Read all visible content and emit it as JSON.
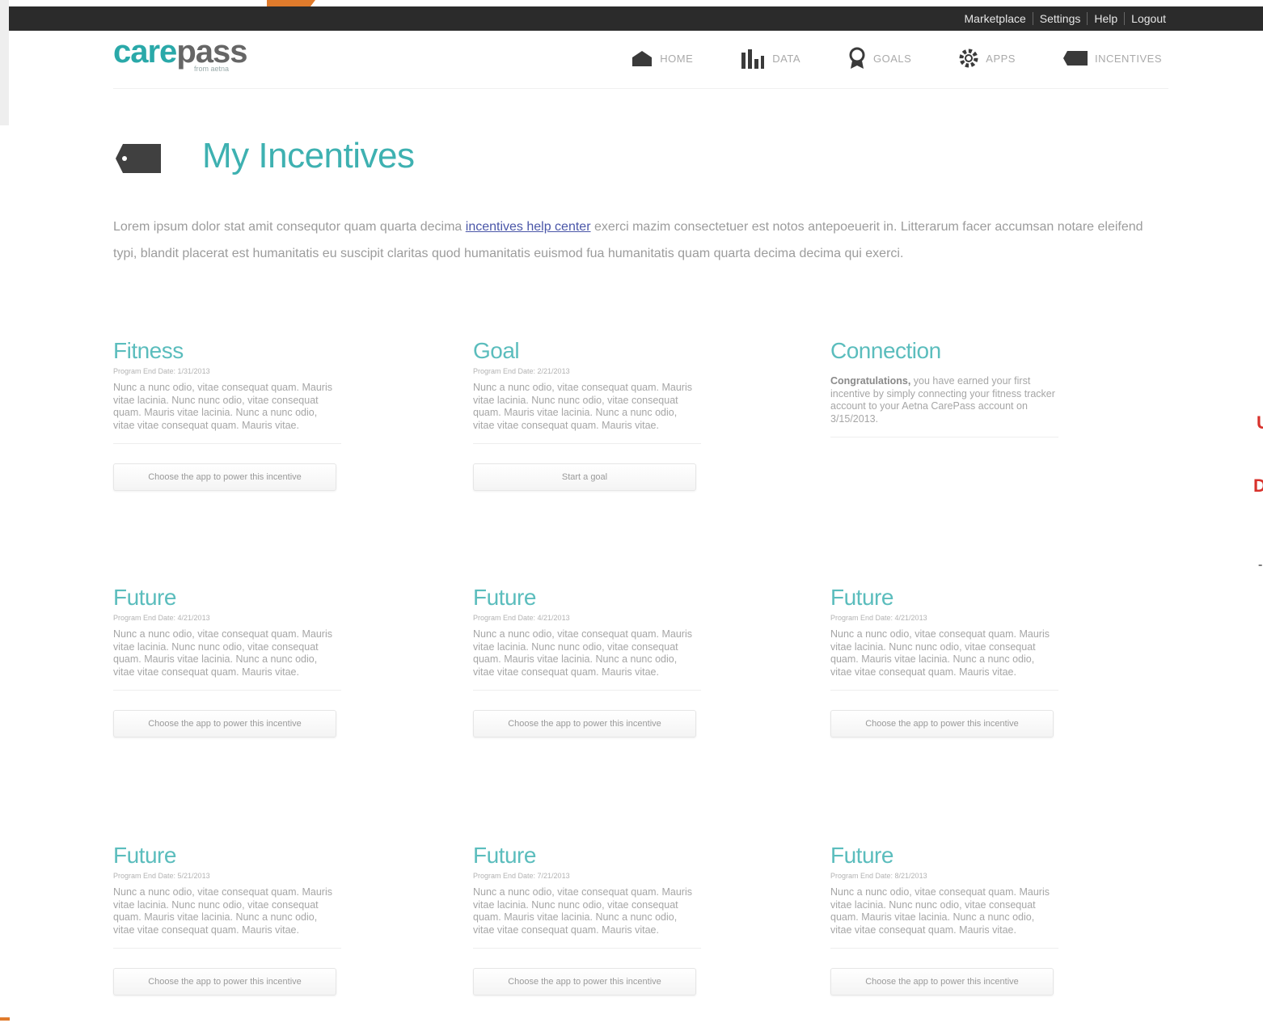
{
  "topbar": {
    "links": [
      "Marketplace",
      "Settings",
      "Help",
      "Logout"
    ]
  },
  "logo": {
    "part1": "care",
    "part2": "pass",
    "sub": "from aetna"
  },
  "nav": {
    "items": [
      "HOME",
      "DATA",
      "GOALS",
      "APPS",
      "INCENTIVES"
    ]
  },
  "page": {
    "title": "My Incentives",
    "intro_before": "Lorem ipsum dolor stat amit consequtor quam quarta decima ",
    "intro_link": "incentives help center",
    "intro_after": " exerci mazim consectetuer est notos antepoeuerit in. Litterarum facer accumsan notare eleifend typi, blandit placerat est humanitatis eu suscipit claritas quod humanitatis euismod fua humanitatis quam quarta decima decima qui exerci."
  },
  "cards": [
    {
      "title": "Fitness",
      "date": "Program End Date: 1/31/2013",
      "body": "Nunc a nunc odio, vitae consequat quam. Mauris vitae lacinia. Nunc nunc odio, vitae consequat quam. Mauris vitae lacinia. Nunc a nunc odio, vitae vitae consequat quam. Mauris vitae.",
      "button": "Choose the app to power this incentive"
    },
    {
      "title": "Goal",
      "date": "Program End Date: 2/21/2013",
      "body": "Nunc a nunc odio, vitae consequat quam. Mauris vitae lacinia. Nunc nunc odio, vitae consequat quam. Mauris vitae lacinia. Nunc a nunc odio, vitae vitae consequat quam. Mauris vitae.",
      "button": "Start a goal"
    },
    {
      "title": "Connection",
      "date": "",
      "body_bold": "Congratulations,",
      "body": " you have earned your first incentive by simply connecting your fitness tracker account to your Aetna CarePass account on 3/15/2013.",
      "button": ""
    },
    {
      "title": "Future",
      "date": "Program End Date: 4/21/2013",
      "body": "Nunc a nunc odio, vitae consequat quam. Mauris vitae lacinia. Nunc nunc odio, vitae consequat quam. Mauris vitae lacinia. Nunc a nunc odio, vitae vitae consequat quam. Mauris vitae.",
      "button": "Choose the app to power this incentive"
    },
    {
      "title": "Future",
      "date": "Program End Date: 4/21/2013",
      "body": "Nunc a nunc odio, vitae consequat quam. Mauris vitae lacinia. Nunc nunc odio, vitae consequat quam. Mauris vitae lacinia. Nunc a nunc odio, vitae vitae consequat quam. Mauris vitae.",
      "button": "Choose the app to power this incentive"
    },
    {
      "title": "Future",
      "date": "Program End Date: 4/21/2013",
      "body": "Nunc a nunc odio, vitae consequat quam. Mauris vitae lacinia. Nunc nunc odio, vitae consequat quam. Mauris vitae lacinia. Nunc a nunc odio, vitae vitae consequat quam. Mauris vitae.",
      "button": "Choose the app to power this incentive"
    },
    {
      "title": "Future",
      "date": "Program End Date: 5/21/2013",
      "body": "Nunc a nunc odio, vitae consequat quam. Mauris vitae lacinia. Nunc nunc odio, vitae consequat quam. Mauris vitae lacinia. Nunc a nunc odio, vitae vitae consequat quam. Mauris vitae.",
      "button": "Choose the app to power this incentive"
    },
    {
      "title": "Future",
      "date": "Program End Date: 7/21/2013",
      "body": "Nunc a nunc odio, vitae consequat quam. Mauris vitae lacinia. Nunc nunc odio, vitae consequat quam. Mauris vitae lacinia. Nunc a nunc odio, vitae vitae consequat quam. Mauris vitae.",
      "button": "Choose the app to power this incentive"
    },
    {
      "title": "Future",
      "date": "Program End Date: 8/21/2013",
      "body": "Nunc a nunc odio, vitae consequat quam. Mauris vitae lacinia. Nunc nunc odio, vitae consequat quam. Mauris vitae lacinia. Nunc a nunc odio, vitae vitae consequat quam. Mauris vitae.",
      "button": "Choose the app to power this incentive"
    }
  ],
  "edge_marks": [
    "U",
    "D",
    "-"
  ],
  "colors": {
    "accent": "#3eb1b1",
    "topbar": "#2b2b2b",
    "link": "#4a56a8",
    "edge_orange": "#e07b2c",
    "edge_red": "#d8322c"
  }
}
